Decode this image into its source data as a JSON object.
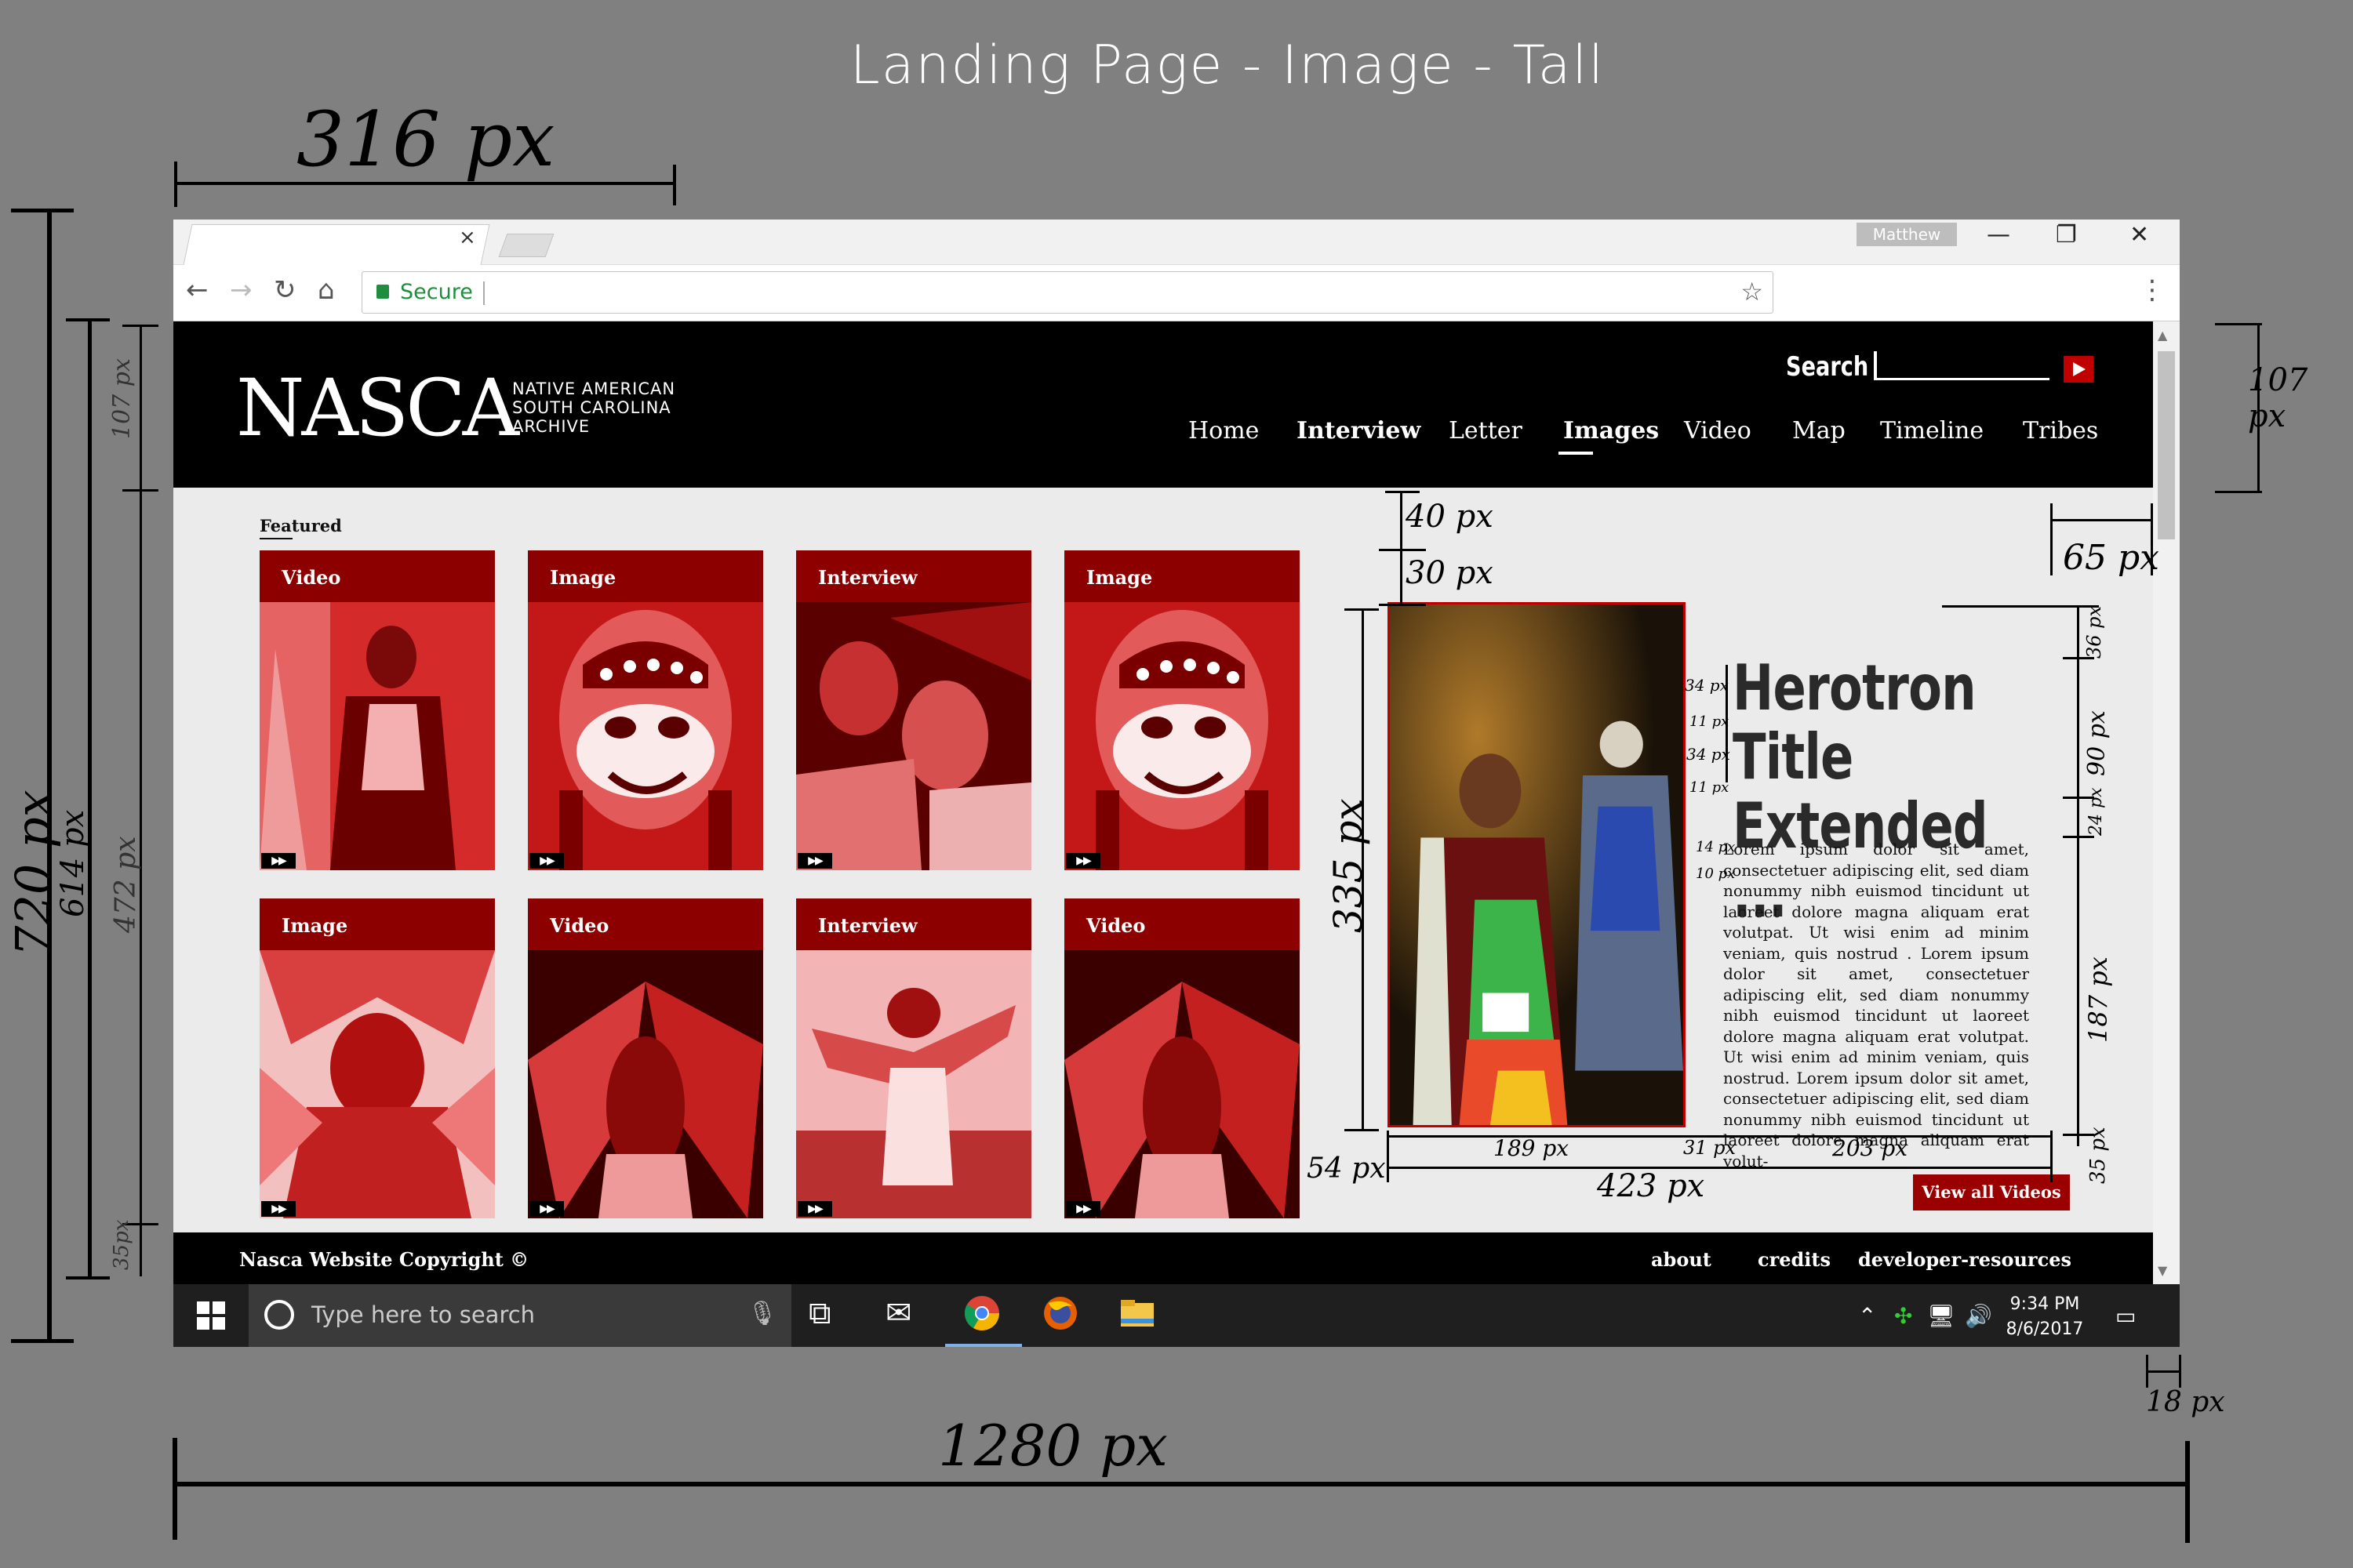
{
  "page_title": "Landing Page - Image - Tall",
  "annotations": {
    "top_width": "316 px",
    "bottom_width": "1280 px",
    "left_total": "720 px",
    "left_614": "614 px",
    "left_472": "472 px",
    "left_107": "107 px",
    "left_35": "35px",
    "right_107": "107 px",
    "hero_40": "40 px",
    "hero_30": "30 px",
    "hero_65": "65 px",
    "hero_335": "335 px",
    "hero_54": "54 px",
    "hero_189": "189 px",
    "hero_31": "31 px",
    "hero_203": "203 px",
    "hero_423": "423 px",
    "taskbar_18": "18 px",
    "right_36": "36 px",
    "right_90": "90 px",
    "right_24": "24 px",
    "right_187": "187 px",
    "right_35": "35 px",
    "small_34a": "34 px",
    "small_11a": "11 px",
    "small_34b": "34 px",
    "small_11b": "11 px",
    "small_14": "14 px",
    "small_10": "10 px"
  },
  "browser": {
    "tab_close": "×",
    "user": "Matthew",
    "minimize": "—",
    "maximize": "❐",
    "close": "✕",
    "back": "←",
    "forward": "→",
    "reload": "↻",
    "home": "⌂",
    "secure": "Secure",
    "bookmark": "☆",
    "menu": "⋮"
  },
  "site": {
    "logo": "NASCA",
    "logo_sub": [
      "NATIVE AMERICAN",
      "SOUTH CAROLINA",
      "ARCHIVE"
    ],
    "search_label": "Search",
    "nav": [
      "Home",
      "Interview",
      "Letter",
      "Images",
      "Video",
      "Map",
      "Timeline",
      "Tribes"
    ],
    "featured_label": "Featured",
    "cards": [
      {
        "label": "Video"
      },
      {
        "label": "Image"
      },
      {
        "label": "Interview"
      },
      {
        "label": "Image"
      },
      {
        "label": "Image"
      },
      {
        "label": "Video"
      },
      {
        "label": "Interview"
      },
      {
        "label": "Video"
      }
    ],
    "play_badge": "▶▶",
    "hero_title": "Herotron Title Extended ...",
    "hero_body": "Lorem ipsum dolor sit amet, consectetuer adipiscing elit, sed diam nonummy nibh euismod tincidunt ut laoreet dolore magna aliquam erat volutpat. Ut wisi enim ad minim veniam, quis nostrud . Lorem ipsum dolor sit amet, consectetuer adipiscing elit, sed diam nonummy nibh euismod tincidunt ut laoreet dolore magna aliquam erat volutpat. Ut wisi enim ad minim veniam, quis nostrud. Lorem ipsum dolor sit amet, consectetuer adipiscing elit, sed diam nonummy nibh euismod tincidunt ut laoreet dolore magna aliquam erat volut-",
    "view_all": "View all Videos",
    "footer_copy": "Nasca Website Copyright ©",
    "footer_links": [
      "about",
      "credits",
      "developer-resources"
    ]
  },
  "taskbar": {
    "search_placeholder": "Type here to search",
    "time": "9:34 PM",
    "date": "8/6/2017"
  },
  "colors": {
    "accent_red": "#8c0000",
    "header_black": "#000000",
    "background_gray": "#808080"
  }
}
